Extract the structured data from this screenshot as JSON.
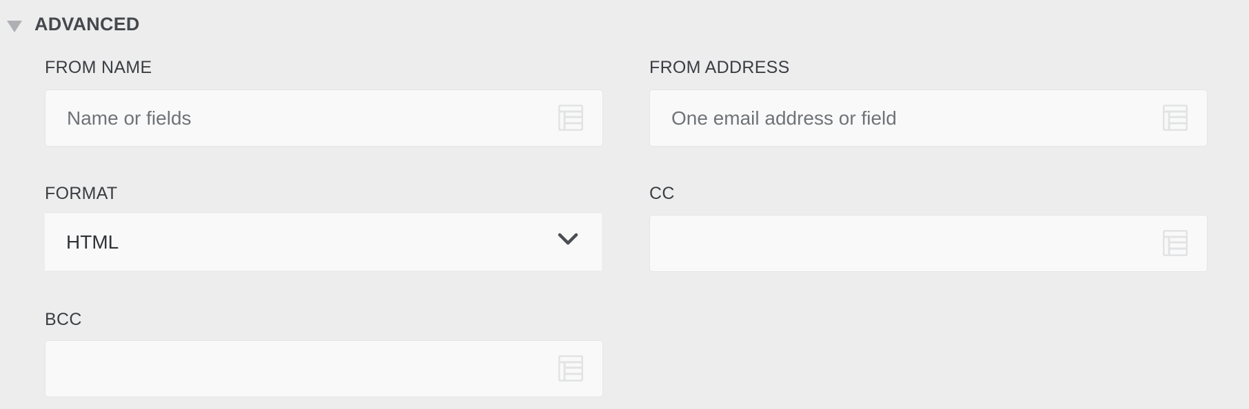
{
  "section": {
    "title": "ADVANCED",
    "toggle_icon": "triangle-down-icon"
  },
  "fields": {
    "from_name": {
      "label": "FROM NAME",
      "placeholder": "Name or fields",
      "value": "",
      "icon": "field-list-icon"
    },
    "from_address": {
      "label": "FROM ADDRESS",
      "placeholder": "One email address or field",
      "value": "",
      "icon": "field-list-icon"
    },
    "format": {
      "label": "FORMAT",
      "selected": "HTML",
      "icon": "chevron-down-icon"
    },
    "cc": {
      "label": "CC",
      "placeholder": "",
      "value": "",
      "icon": "field-list-icon"
    },
    "bcc": {
      "label": "BCC",
      "placeholder": "",
      "value": "",
      "icon": "field-list-icon"
    }
  },
  "colors": {
    "background": "#ededee",
    "field_background": "#f9f9f9",
    "label_text": "#3a3d41",
    "placeholder_text": "#6f7378",
    "icon_color": "#e2e3e4"
  }
}
